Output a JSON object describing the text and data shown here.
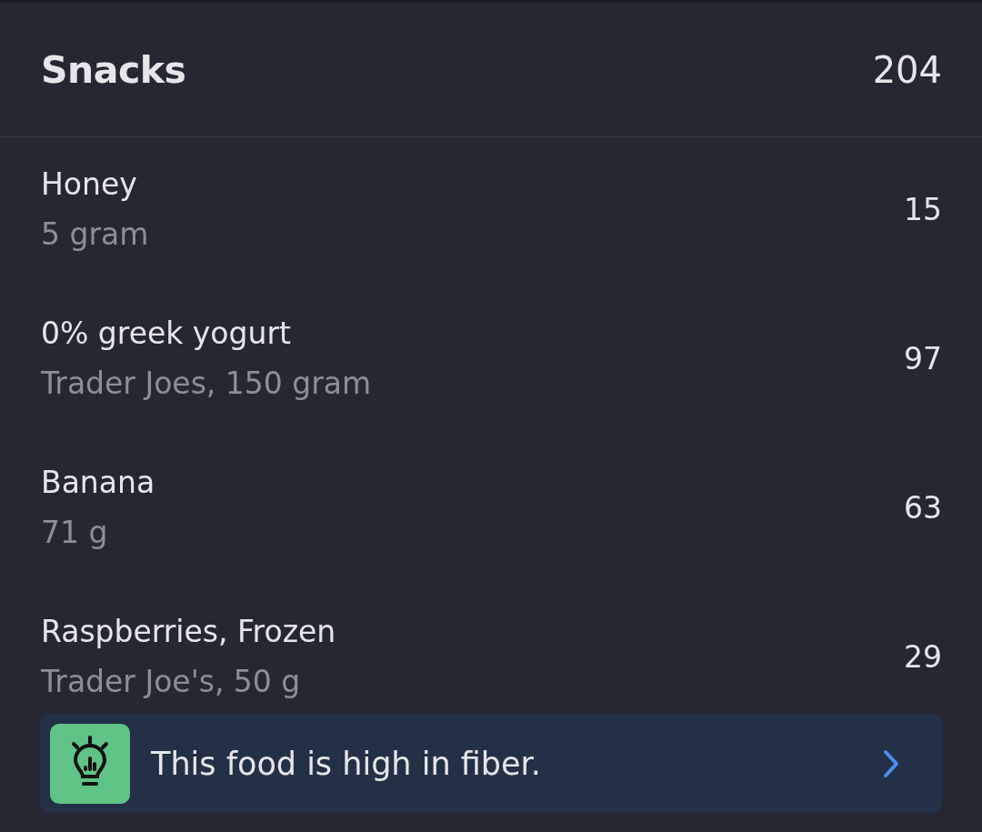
{
  "section": {
    "title": "Snacks",
    "total": "204"
  },
  "items": [
    {
      "name": "Honey",
      "detail": "5 gram",
      "calories": "15"
    },
    {
      "name": "0% greek yogurt",
      "detail": "Trader Joes, 150 gram",
      "calories": "97"
    },
    {
      "name": "Banana",
      "detail": "71 g",
      "calories": "63"
    },
    {
      "name": "Raspberries, Frozen",
      "detail": "Trader Joe's, 50 g",
      "calories": "29",
      "tip": "This food is high in fiber."
    }
  ]
}
